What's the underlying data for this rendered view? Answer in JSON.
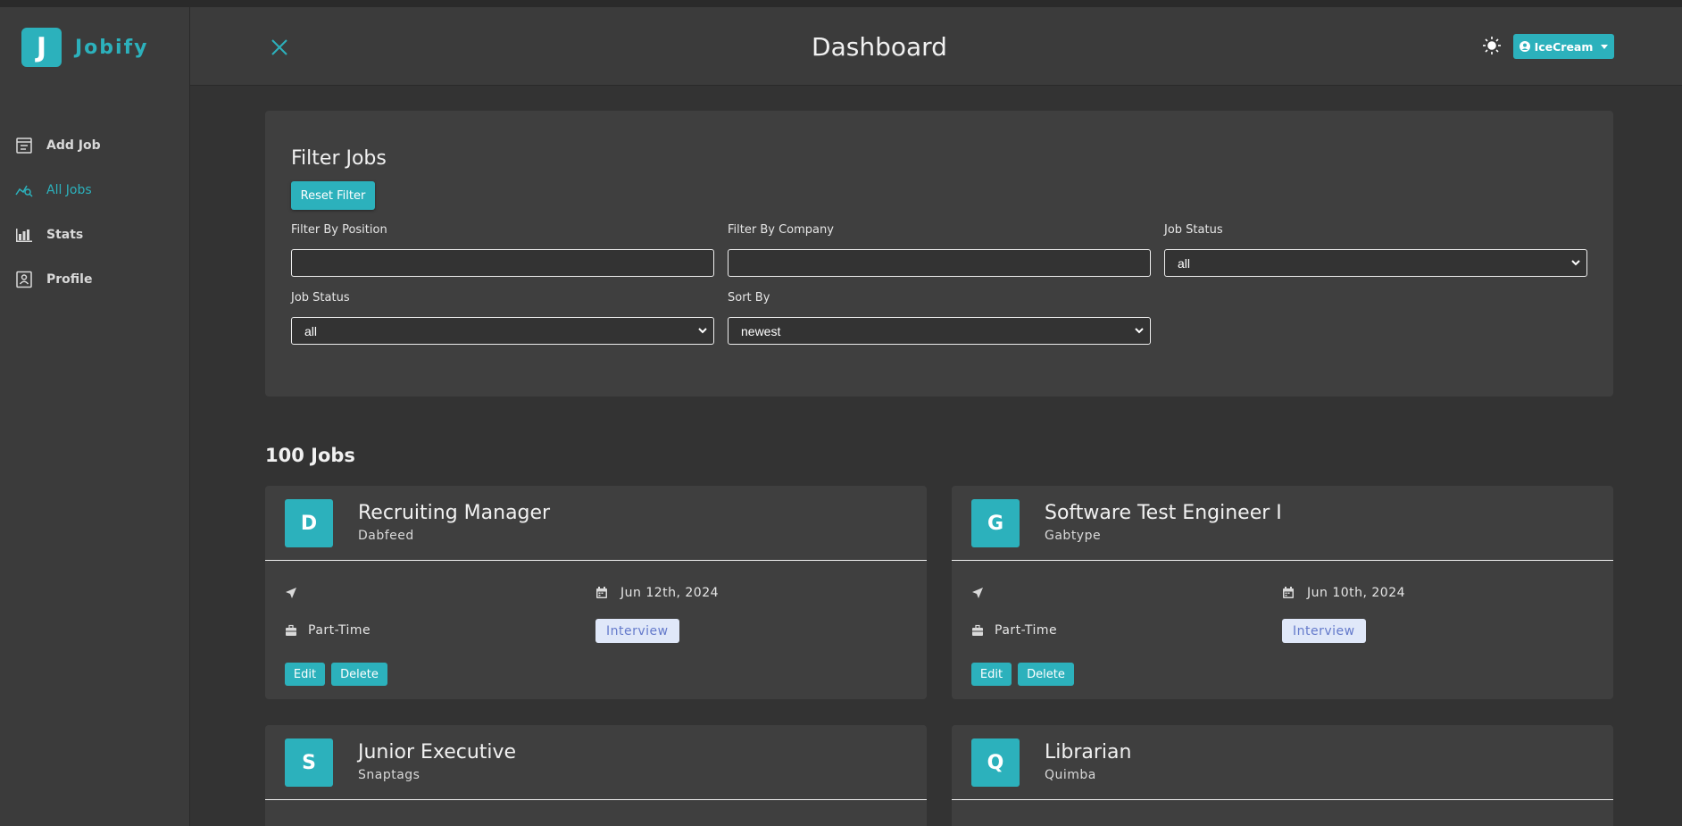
{
  "app": {
    "logo_letter": "J",
    "name": "Jobify"
  },
  "sidebar": {
    "items": [
      {
        "label": "Add Job",
        "icon": "add-job-icon",
        "active": false
      },
      {
        "label": "All Jobs",
        "icon": "all-jobs-icon",
        "active": true
      },
      {
        "label": "Stats",
        "icon": "stats-icon",
        "active": false
      },
      {
        "label": "Profile",
        "icon": "profile-icon",
        "active": false
      }
    ]
  },
  "header": {
    "title": "Dashboard",
    "user_name": "IceCream"
  },
  "filter": {
    "title": "Filter Jobs",
    "reset_label": "Reset Filter",
    "position_label": "Filter By Position",
    "position_value": "",
    "company_label": "Filter By Company",
    "company_value": "",
    "status_label": "Job Status",
    "status_value": "all",
    "type_label": "Job Status",
    "type_value": "all",
    "sort_label": "Sort By",
    "sort_value": "newest"
  },
  "jobs_count": "100 Jobs",
  "jobs": [
    {
      "letter": "D",
      "title": "Recruiting Manager",
      "company": "Dabfeed",
      "location": "",
      "date": "Jun 12th, 2024",
      "type": "Part-Time",
      "status": "Interview",
      "edit": "Edit",
      "delete": "Delete"
    },
    {
      "letter": "G",
      "title": "Software Test Engineer I",
      "company": "Gabtype",
      "location": "",
      "date": "Jun 10th, 2024",
      "type": "Part-Time",
      "status": "Interview",
      "edit": "Edit",
      "delete": "Delete"
    },
    {
      "letter": "S",
      "title": "Junior Executive",
      "company": "Snaptags"
    },
    {
      "letter": "Q",
      "title": "Librarian",
      "company": "Quimba"
    }
  ],
  "colors": {
    "accent": "#2cb1bc",
    "background": "#333333",
    "panel": "#3f3f3f",
    "status_bg": "#e0e8f9",
    "status_text": "#647acb"
  }
}
